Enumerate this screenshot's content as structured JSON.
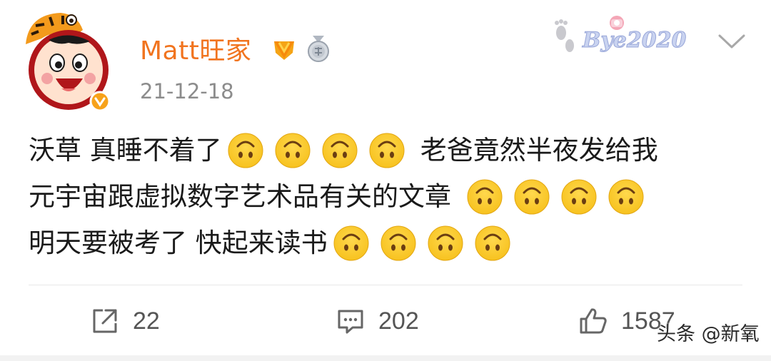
{
  "post": {
    "username": "Matt旺家",
    "timestamp": "21-12-18",
    "decor_text": "Bye2020",
    "badges": [
      "vip-v-badge",
      "medal-badge"
    ],
    "emoji_name": "upside-down-smile",
    "content": {
      "line1_a": "沃草 真睡不着了",
      "line1_b": "老爸竟然半夜发给我",
      "line2_a": "元宇宙跟虚拟数字艺术品有关的文章",
      "line3_a": "明天要被考了 快起来读书"
    },
    "actions": {
      "repost_count": "22",
      "comment_count": "202",
      "like_count": "1587"
    }
  },
  "watermark": "头条 @新氧",
  "colors": {
    "username": "#f1741f",
    "timestamp": "#8c8c8c",
    "text": "#1a1a1a",
    "icon": "#666666",
    "emoji_face": "#f7c21f"
  }
}
